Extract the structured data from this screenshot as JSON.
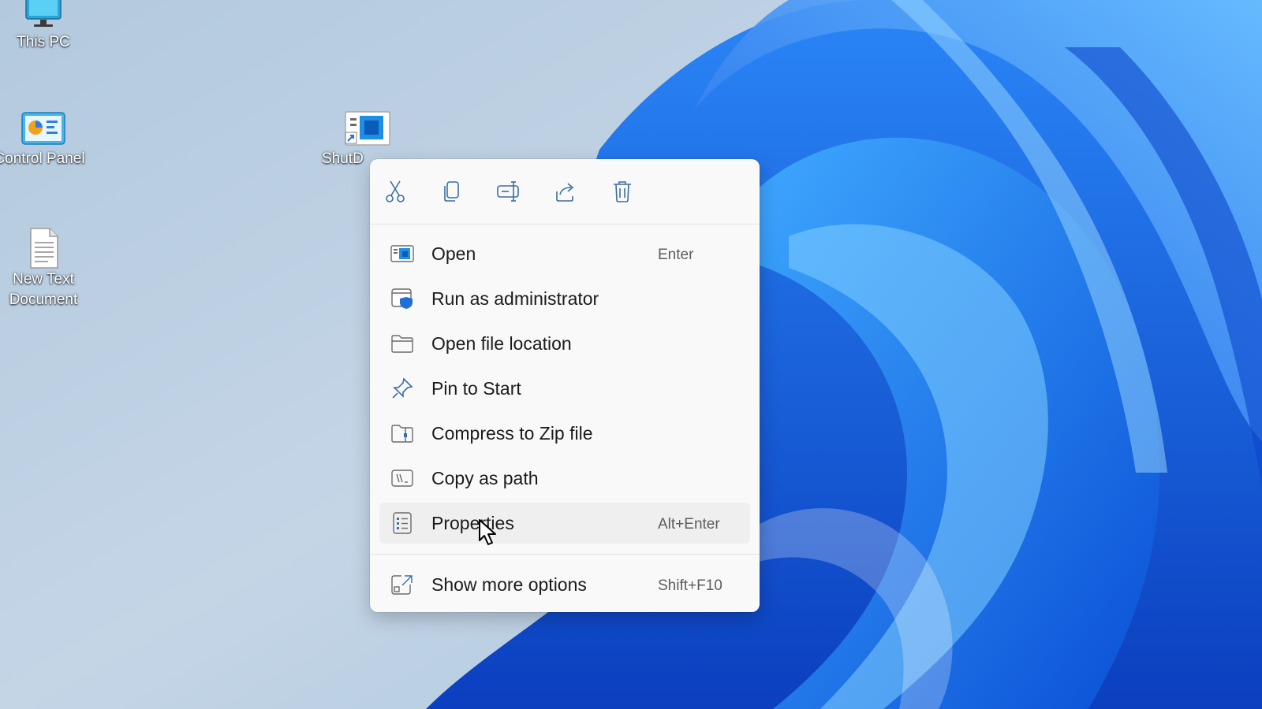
{
  "desktop": {
    "icons": [
      {
        "label": "This PC",
        "icon": "monitor-icon"
      },
      {
        "label": "Control Panel",
        "icon": "control-panel-icon"
      },
      {
        "label": "New Text Document",
        "icon": "text-file-icon"
      },
      {
        "label": "ShutD",
        "icon": "shortcut-icon"
      }
    ]
  },
  "context_menu": {
    "toolbar": [
      {
        "name": "cut-icon"
      },
      {
        "name": "copy-icon"
      },
      {
        "name": "rename-icon"
      },
      {
        "name": "share-icon"
      },
      {
        "name": "delete-icon"
      }
    ],
    "items": [
      {
        "label": "Open",
        "shortcut": "Enter",
        "icon": "open-icon"
      },
      {
        "label": "Run as administrator",
        "shortcut": "",
        "icon": "shield-icon"
      },
      {
        "label": "Open file location",
        "shortcut": "",
        "icon": "folder-icon"
      },
      {
        "label": "Pin to Start",
        "shortcut": "",
        "icon": "pin-icon"
      },
      {
        "label": "Compress to Zip file",
        "shortcut": "",
        "icon": "zip-icon"
      },
      {
        "label": "Copy as path",
        "shortcut": "",
        "icon": "path-icon"
      },
      {
        "label": "Properties",
        "shortcut": "Alt+Enter",
        "icon": "properties-icon",
        "hovered": true
      },
      {
        "label": "Show more options",
        "shortcut": "Shift+F10",
        "icon": "more-options-icon"
      }
    ]
  },
  "colors": {
    "accent": "#0078d4",
    "menu_bg": "#f9f9f9",
    "wallpaper_blue": "#1565e0"
  }
}
